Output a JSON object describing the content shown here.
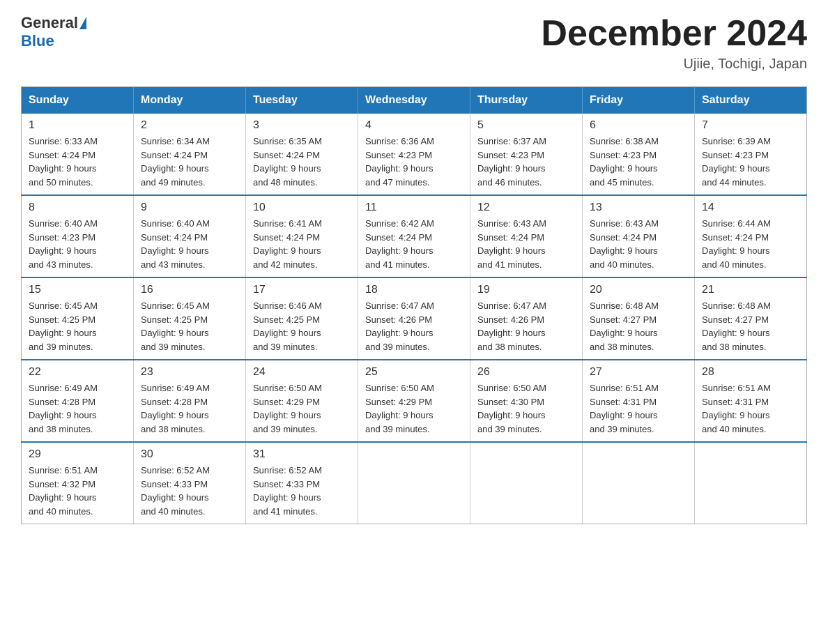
{
  "header": {
    "logo_general": "General",
    "logo_blue": "Blue",
    "month_title": "December 2024",
    "location": "Ujiie, Tochigi, Japan"
  },
  "weekdays": [
    "Sunday",
    "Monday",
    "Tuesday",
    "Wednesday",
    "Thursday",
    "Friday",
    "Saturday"
  ],
  "weeks": [
    [
      {
        "day": "1",
        "sunrise": "6:33 AM",
        "sunset": "4:24 PM",
        "daylight": "9 hours and 50 minutes."
      },
      {
        "day": "2",
        "sunrise": "6:34 AM",
        "sunset": "4:24 PM",
        "daylight": "9 hours and 49 minutes."
      },
      {
        "day": "3",
        "sunrise": "6:35 AM",
        "sunset": "4:24 PM",
        "daylight": "9 hours and 48 minutes."
      },
      {
        "day": "4",
        "sunrise": "6:36 AM",
        "sunset": "4:23 PM",
        "daylight": "9 hours and 47 minutes."
      },
      {
        "day": "5",
        "sunrise": "6:37 AM",
        "sunset": "4:23 PM",
        "daylight": "9 hours and 46 minutes."
      },
      {
        "day": "6",
        "sunrise": "6:38 AM",
        "sunset": "4:23 PM",
        "daylight": "9 hours and 45 minutes."
      },
      {
        "day": "7",
        "sunrise": "6:39 AM",
        "sunset": "4:23 PM",
        "daylight": "9 hours and 44 minutes."
      }
    ],
    [
      {
        "day": "8",
        "sunrise": "6:40 AM",
        "sunset": "4:23 PM",
        "daylight": "9 hours and 43 minutes."
      },
      {
        "day": "9",
        "sunrise": "6:40 AM",
        "sunset": "4:24 PM",
        "daylight": "9 hours and 43 minutes."
      },
      {
        "day": "10",
        "sunrise": "6:41 AM",
        "sunset": "4:24 PM",
        "daylight": "9 hours and 42 minutes."
      },
      {
        "day": "11",
        "sunrise": "6:42 AM",
        "sunset": "4:24 PM",
        "daylight": "9 hours and 41 minutes."
      },
      {
        "day": "12",
        "sunrise": "6:43 AM",
        "sunset": "4:24 PM",
        "daylight": "9 hours and 41 minutes."
      },
      {
        "day": "13",
        "sunrise": "6:43 AM",
        "sunset": "4:24 PM",
        "daylight": "9 hours and 40 minutes."
      },
      {
        "day": "14",
        "sunrise": "6:44 AM",
        "sunset": "4:24 PM",
        "daylight": "9 hours and 40 minutes."
      }
    ],
    [
      {
        "day": "15",
        "sunrise": "6:45 AM",
        "sunset": "4:25 PM",
        "daylight": "9 hours and 39 minutes."
      },
      {
        "day": "16",
        "sunrise": "6:45 AM",
        "sunset": "4:25 PM",
        "daylight": "9 hours and 39 minutes."
      },
      {
        "day": "17",
        "sunrise": "6:46 AM",
        "sunset": "4:25 PM",
        "daylight": "9 hours and 39 minutes."
      },
      {
        "day": "18",
        "sunrise": "6:47 AM",
        "sunset": "4:26 PM",
        "daylight": "9 hours and 39 minutes."
      },
      {
        "day": "19",
        "sunrise": "6:47 AM",
        "sunset": "4:26 PM",
        "daylight": "9 hours and 38 minutes."
      },
      {
        "day": "20",
        "sunrise": "6:48 AM",
        "sunset": "4:27 PM",
        "daylight": "9 hours and 38 minutes."
      },
      {
        "day": "21",
        "sunrise": "6:48 AM",
        "sunset": "4:27 PM",
        "daylight": "9 hours and 38 minutes."
      }
    ],
    [
      {
        "day": "22",
        "sunrise": "6:49 AM",
        "sunset": "4:28 PM",
        "daylight": "9 hours and 38 minutes."
      },
      {
        "day": "23",
        "sunrise": "6:49 AM",
        "sunset": "4:28 PM",
        "daylight": "9 hours and 38 minutes."
      },
      {
        "day": "24",
        "sunrise": "6:50 AM",
        "sunset": "4:29 PM",
        "daylight": "9 hours and 39 minutes."
      },
      {
        "day": "25",
        "sunrise": "6:50 AM",
        "sunset": "4:29 PM",
        "daylight": "9 hours and 39 minutes."
      },
      {
        "day": "26",
        "sunrise": "6:50 AM",
        "sunset": "4:30 PM",
        "daylight": "9 hours and 39 minutes."
      },
      {
        "day": "27",
        "sunrise": "6:51 AM",
        "sunset": "4:31 PM",
        "daylight": "9 hours and 39 minutes."
      },
      {
        "day": "28",
        "sunrise": "6:51 AM",
        "sunset": "4:31 PM",
        "daylight": "9 hours and 40 minutes."
      }
    ],
    [
      {
        "day": "29",
        "sunrise": "6:51 AM",
        "sunset": "4:32 PM",
        "daylight": "9 hours and 40 minutes."
      },
      {
        "day": "30",
        "sunrise": "6:52 AM",
        "sunset": "4:33 PM",
        "daylight": "9 hours and 40 minutes."
      },
      {
        "day": "31",
        "sunrise": "6:52 AM",
        "sunset": "4:33 PM",
        "daylight": "9 hours and 41 minutes."
      },
      null,
      null,
      null,
      null
    ]
  ],
  "labels": {
    "sunrise": "Sunrise:",
    "sunset": "Sunset:",
    "daylight": "Daylight:"
  }
}
